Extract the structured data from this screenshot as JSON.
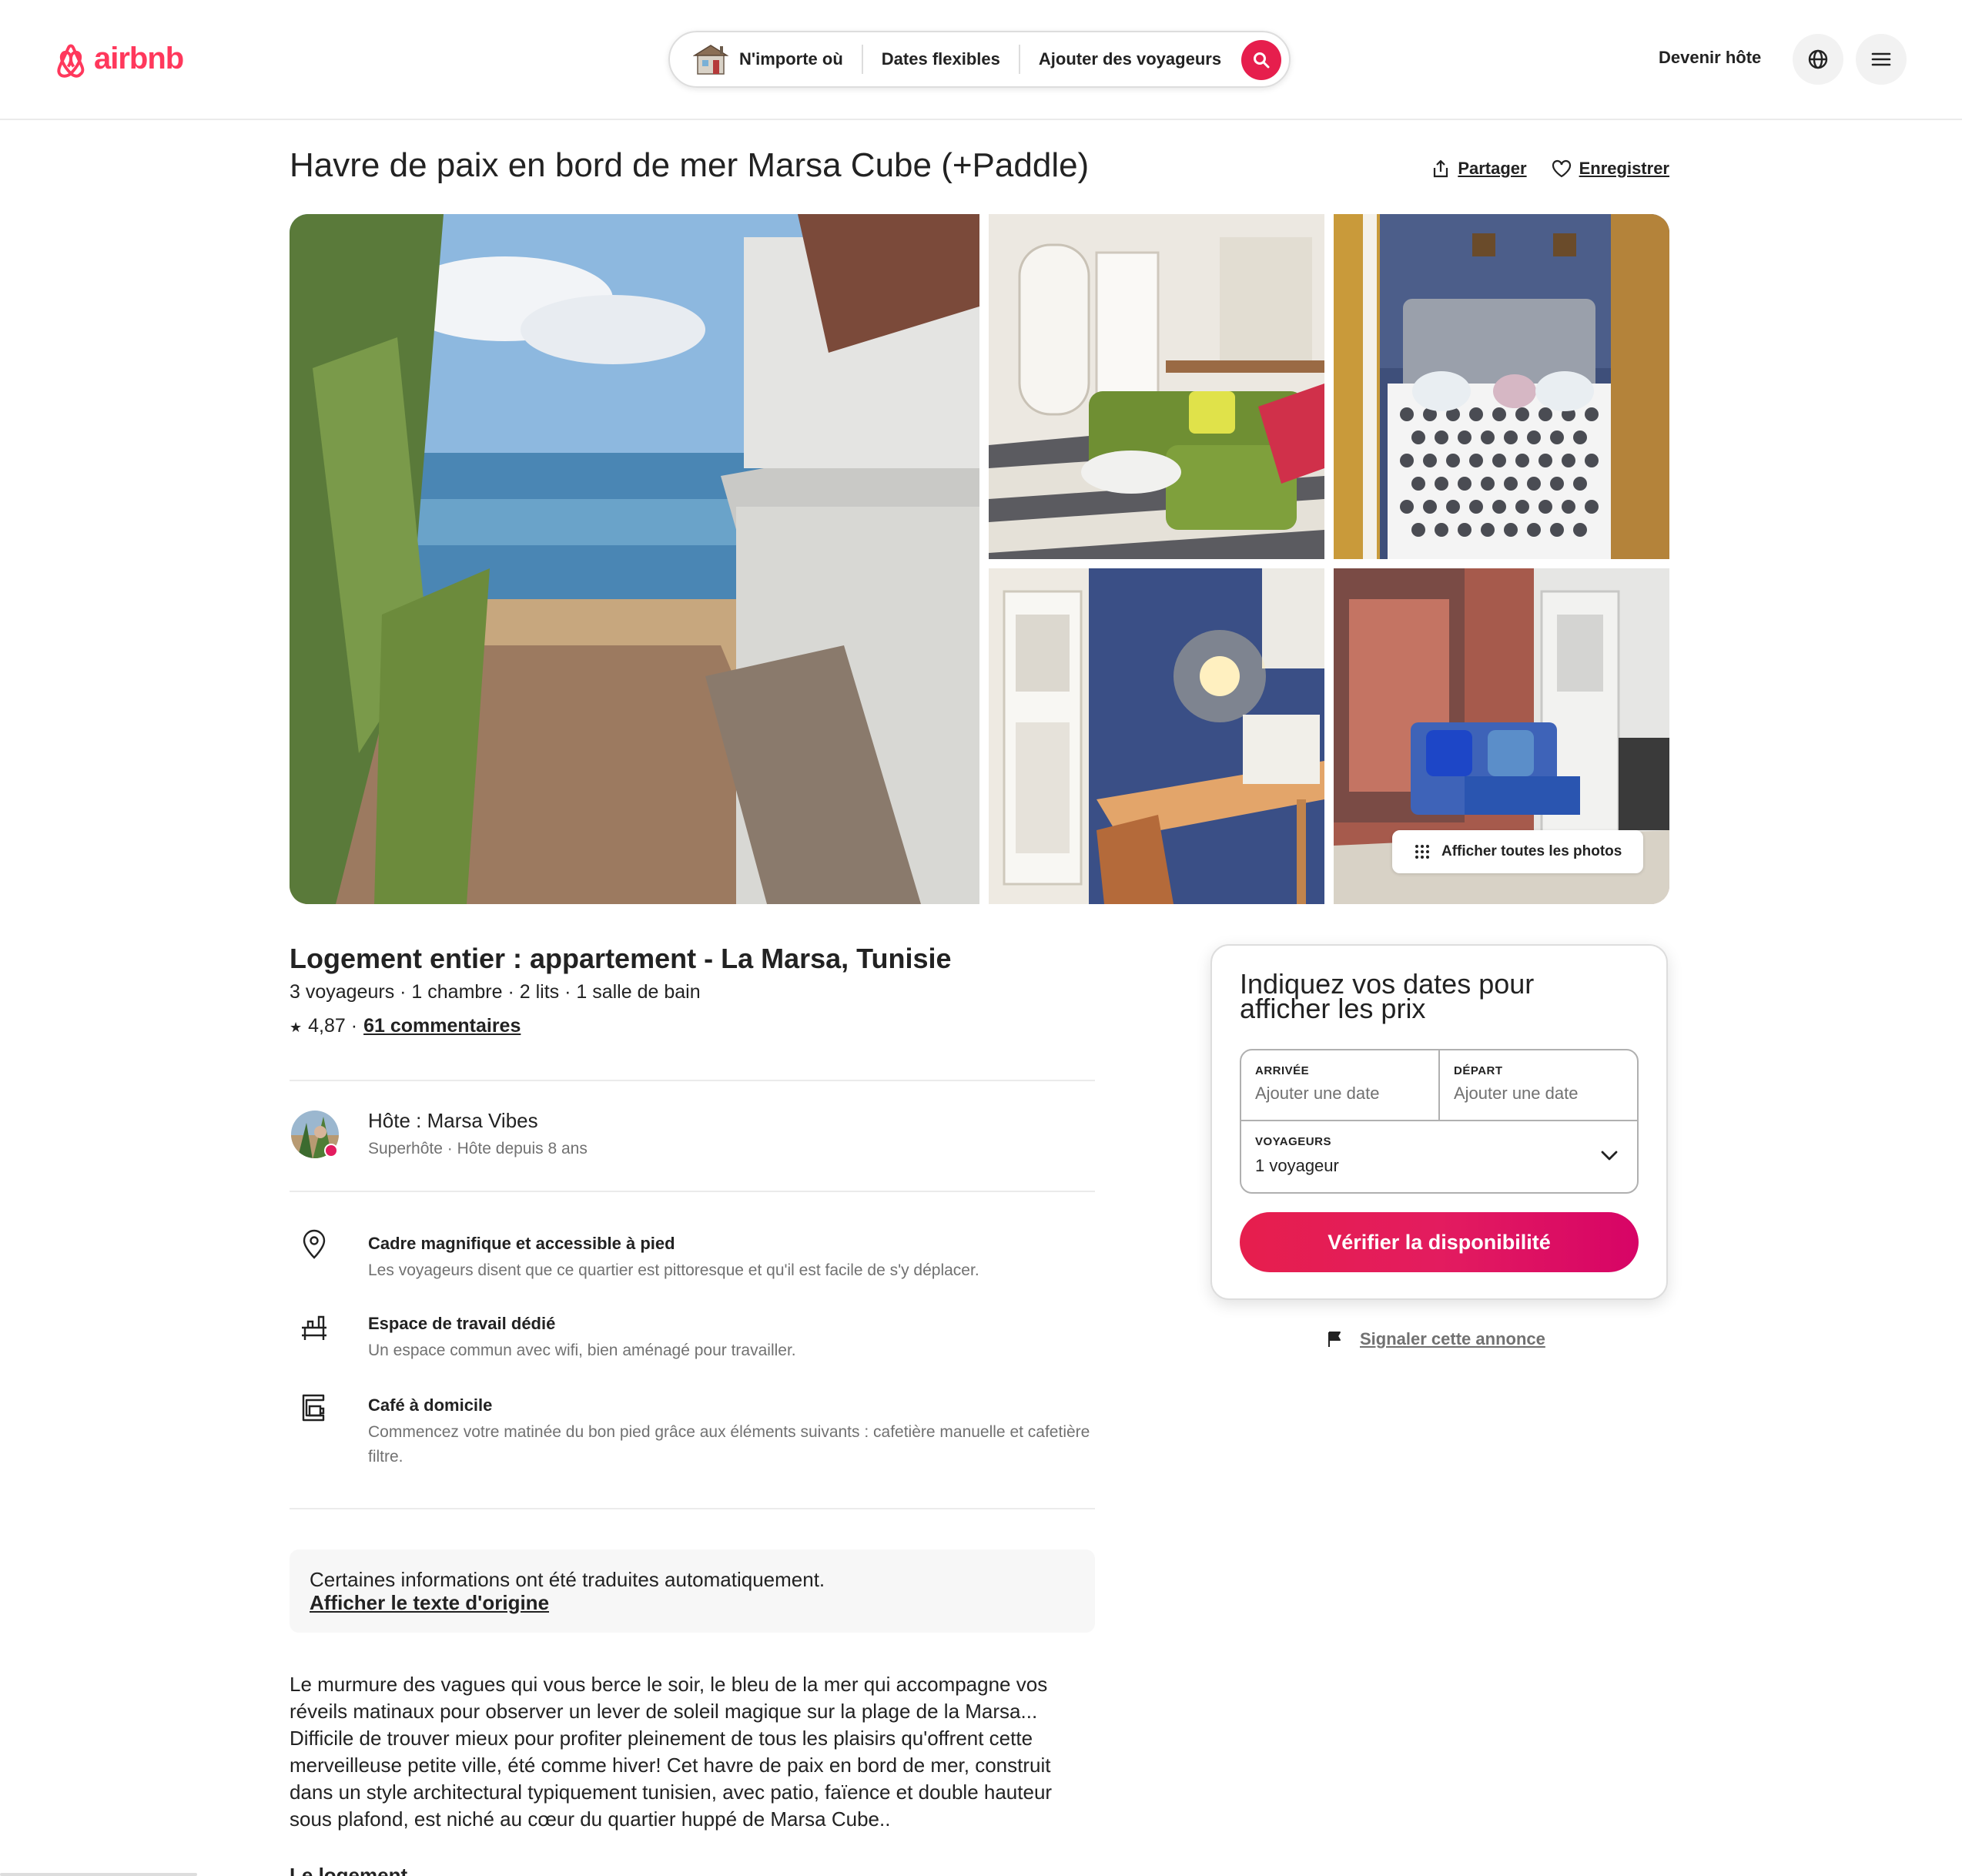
{
  "header": {
    "logo_text": "airbnb",
    "brand_color": "#ff385c",
    "search": {
      "where": "N'importe où",
      "when": "Dates flexibles",
      "who": "Ajouter des voyageurs"
    },
    "become_host": "Devenir hôte",
    "icons": [
      "globe-icon",
      "menu-icon",
      "search-icon",
      "airbnb-logo-icon"
    ]
  },
  "listing": {
    "title": "Havre de paix en bord de mer Marsa Cube (+Paddle)",
    "share_label": "Partager",
    "save_label": "Enregistrer",
    "show_all_photos": "Afficher toutes les photos",
    "subtitle": "Logement entier : appartement - La Marsa, Tunisie",
    "capacity": "3 voyageurs · 1 chambre · 2 lits · 1 salle de bain",
    "rating_star": "★",
    "rating_value": "4,87 ·",
    "reviews_link": "61 commentaires"
  },
  "host": {
    "name": "Hôte : Marsa Vibes",
    "meta": "Superhôte · Hôte depuis 8 ans"
  },
  "highlights": [
    {
      "icon": "location-pin-icon",
      "title": "Cadre magnifique et accessible à pied",
      "description": "Les voyageurs disent que ce quartier est pittoresque et qu'il est facile de s'y déplacer."
    },
    {
      "icon": "desk-icon",
      "title": "Espace de travail dédié",
      "description": "Un espace commun avec wifi, bien aménagé pour travailler."
    },
    {
      "icon": "coffee-maker-icon",
      "title": "Café à domicile",
      "description": "Commencez votre matinée du bon pied grâce aux éléments suivants : cafetière manuelle et cafetière filtre."
    }
  ],
  "translation": {
    "notice": "Certaines informations ont été traduites automatiquement.",
    "link": "Afficher le texte d'origine"
  },
  "description": "Le murmure des vagues qui vous berce le soir, le bleu de la mer qui accompagne vos réveils matinaux pour observer un lever de soleil magique sur la plage de la Marsa... Difficile de trouver mieux pour profiter pleinement de tous les plaisirs qu'offrent cette merveilleuse petite ville, été comme hiver! Cet havre de paix en bord de mer, construit dans un style architectural typiquement tunisien, avec patio, faïence et double hauteur sous plafond, est niché au cœur du quartier huppé de Marsa Cube..",
  "section_heading": "Le logement",
  "booking": {
    "title": "Indiquez vos dates pour afficher les prix",
    "checkin_label": "ARRIVÉE",
    "checkin_value": "Ajouter une date",
    "checkout_label": "DÉPART",
    "checkout_value": "Ajouter une date",
    "guests_label": "VOYAGEURS",
    "guests_value": "1 voyageur",
    "button": "Vérifier la disponibilité",
    "button_color": "#e61e4d"
  },
  "report_link": "Signaler cette annonce"
}
